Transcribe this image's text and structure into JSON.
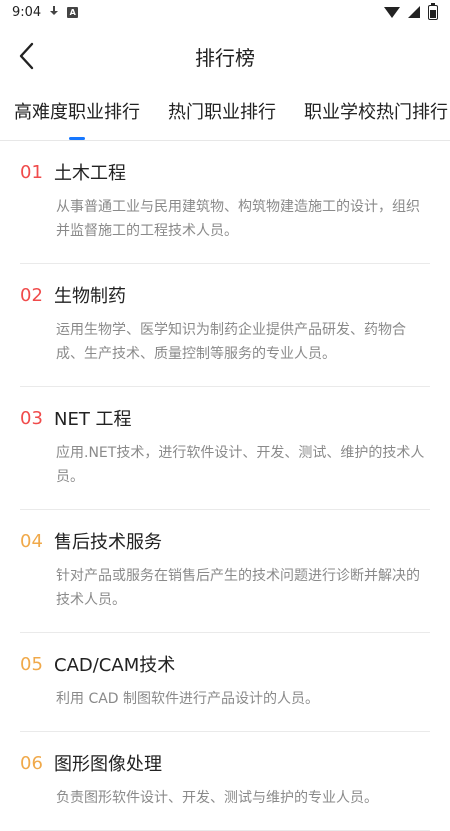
{
  "status": {
    "time": "9:04"
  },
  "header": {
    "title": "排行榜"
  },
  "tabs": [
    {
      "label": "高难度职业排行"
    },
    {
      "label": "热门职业排行"
    },
    {
      "label": "职业学校热门排行"
    }
  ],
  "items": [
    {
      "rank": "01",
      "name": "土木工程",
      "desc": "从事普通工业与民用建筑物、构筑物建造施工的设计，组织并监督施工的工程技术人员。",
      "rank_color": "#f04b4b"
    },
    {
      "rank": "02",
      "name": "生物制药",
      "desc": "运用生物学、医学知识为制药企业提供产品研发、药物合成、生产技术、质量控制等服务的专业人员。",
      "rank_color": "#f04b4b"
    },
    {
      "rank": "03",
      "name": "NET 工程",
      "desc": "应用.NET技术，进行软件设计、开发、测试、维护的技术人员。",
      "rank_color": "#f04b4b"
    },
    {
      "rank": "04",
      "name": "售后技术服务",
      "desc": "针对产品或服务在销售后产生的技术问题进行诊断并解决的技术人员。",
      "rank_color": "#f0a94a"
    },
    {
      "rank": "05",
      "name": "CAD/CAM技术",
      "desc": "利用 CAD 制图软件进行产品设计的人员。",
      "rank_color": "#f0a94a"
    },
    {
      "rank": "06",
      "name": "图形图像处理",
      "desc": "负责图形软件设计、开发、测试与维护的专业人员。",
      "rank_color": "#f0a94a"
    }
  ],
  "colors": {
    "accent_blue": "#1677ff"
  }
}
